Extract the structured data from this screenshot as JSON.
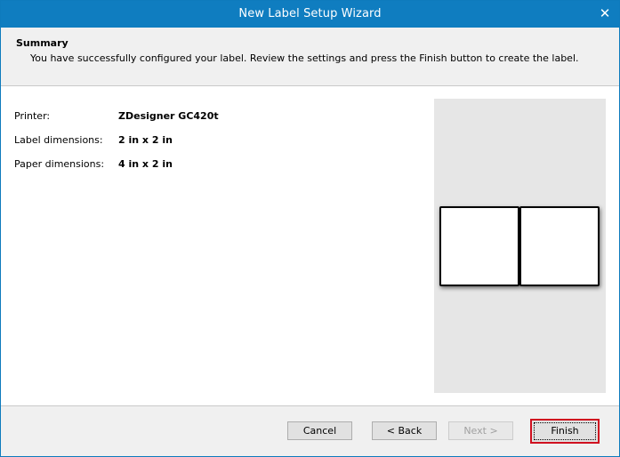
{
  "window": {
    "title": "New Label Setup Wizard"
  },
  "header": {
    "title": "Summary",
    "description": "You have successfully configured your label. Review the settings and press the Finish button to create the label."
  },
  "summary": {
    "rows": [
      {
        "label": "Printer:",
        "value": "ZDesigner GC420t"
      },
      {
        "label": "Label dimensions:",
        "value": "2 in x 2 in"
      },
      {
        "label": "Paper dimensions:",
        "value": "4 in x 2 in"
      }
    ]
  },
  "buttons": {
    "cancel": "Cancel",
    "back": "< Back",
    "next": "Next >",
    "finish": "Finish"
  },
  "icons": {
    "close": "close-icon"
  },
  "colors": {
    "titlebar": "#0f7dc0",
    "finish_highlight": "#d0101f"
  }
}
